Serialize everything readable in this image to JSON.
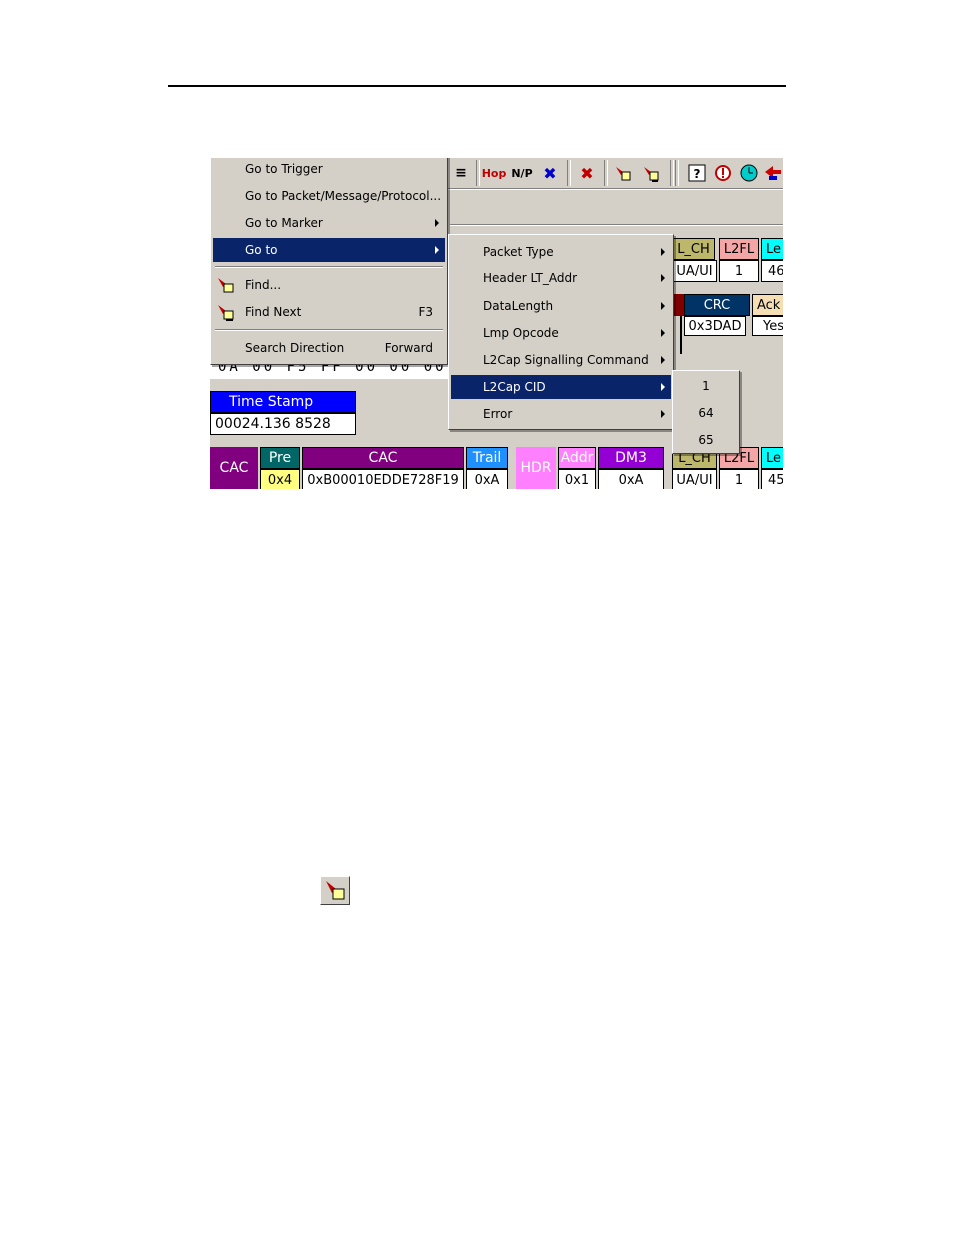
{
  "toolbar": {
    "hop": "Hop",
    "np": "N/P"
  },
  "goto_menu": {
    "items": [
      {
        "label": "Go to Trigger"
      },
      {
        "label": "Go to Packet/Message/Protocol..."
      },
      {
        "label": "Go to Marker"
      },
      {
        "label": "Go to"
      },
      {
        "label": "Find..."
      },
      {
        "label": "Find Next",
        "shortcut": "F3"
      },
      {
        "label": "Search Direction",
        "shortcut": "Forward"
      }
    ]
  },
  "goto_submenu": {
    "items": [
      {
        "label": "Packet Type"
      },
      {
        "label": "Header LT_Addr"
      },
      {
        "label": "DataLength"
      },
      {
        "label": "Lmp Opcode"
      },
      {
        "label": "L2Cap Signalling Command"
      },
      {
        "label": "L2Cap CID"
      },
      {
        "label": "Error"
      }
    ]
  },
  "cid_submenu": {
    "items": [
      "1",
      "64",
      "65"
    ]
  },
  "packet_top": {
    "l_ch": "L_CH",
    "l2fl": "L2FL",
    "le": "Le",
    "l_ch_val": "UA/UI",
    "l2fl_val": "1",
    "le_val": "46",
    "crc": "CRC",
    "crc_val": "0x3DAD",
    "ack": "Ack",
    "ack_val": "Yes"
  },
  "hex_row": "0A 00 F5 FF 00 00 00",
  "timestamp": {
    "label": "Time Stamp",
    "value": "00024.136 8528"
  },
  "packet_row": {
    "cac": "CAC",
    "pre": "Pre",
    "pre_val": "0x4",
    "cac2": "CAC",
    "cac_val": "0xB00010EDDE728F19",
    "trail": "Trail",
    "trail_val": "0xA",
    "hdr": "HDR",
    "addr": "Addr",
    "addr_val": "0x1",
    "dm3": "DM3",
    "dm3_val": "0xA",
    "l_ch": "L_CH",
    "l_ch_val": "UA/UI",
    "l2fl": "L2FL",
    "l2fl_val": "1",
    "le": "Le",
    "le_val": "45"
  },
  "colors": {
    "menu_bg": "#d4d0c8",
    "selection": "#0a246a",
    "timestamp_blue": "#0000ff",
    "cac_purple": "#800080",
    "pre_green": "#006666",
    "pre_val_yellow": "#ffff80",
    "hdr_pink": "#ff80ff",
    "trail_blue": "#1e90ff",
    "l_ch_khaki": "#bdb76b",
    "l2fl_salmon": "#f4a6a6",
    "le_cyan": "#00ffff",
    "crc_navy": "#003366"
  }
}
